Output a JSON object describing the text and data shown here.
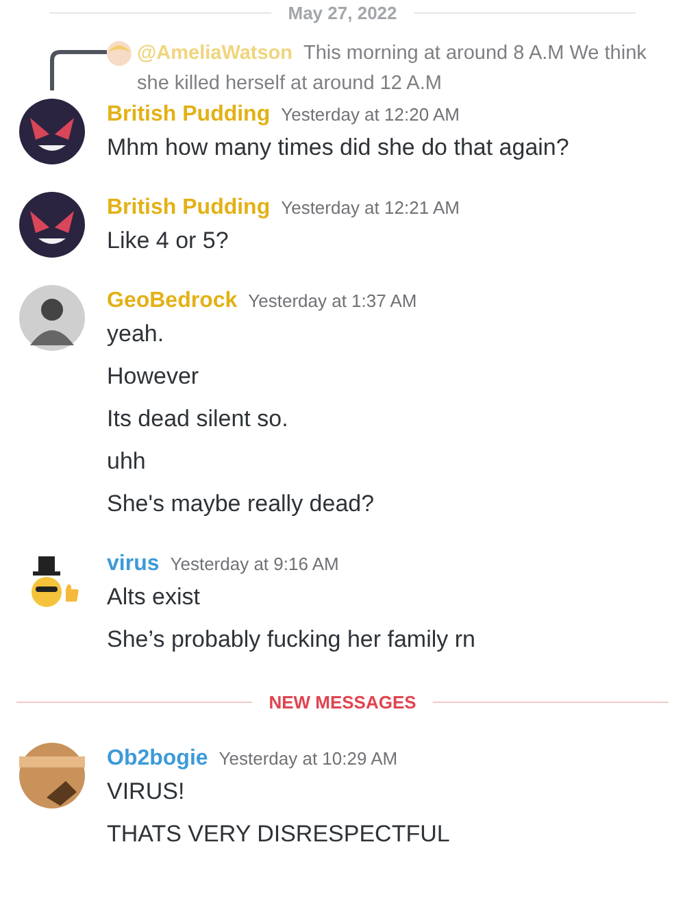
{
  "feed": [
    {
      "kind": "date",
      "label": "May 27, 2022"
    },
    {
      "kind": "message",
      "author": "British Pudding",
      "color": "#e3b116",
      "time": "Yesterday at 12:20 AM",
      "reply": {
        "author": "@AmeliaWatson",
        "color": "#efd57e",
        "text": "This morning at around 8 A.M  We think she killed herself at around 12 A.M"
      },
      "lines": [
        "Mhm how many times did she do that again?"
      ]
    },
    {
      "kind": "message",
      "author": "British Pudding",
      "color": "#e3b116",
      "time": "Yesterday at 12:21 AM",
      "lines": [
        "Like 4 or 5?"
      ]
    },
    {
      "kind": "message",
      "author": "GeoBedrock",
      "color": "#e3b116",
      "time": "Yesterday at 1:37 AM",
      "lines": [
        "yeah.",
        "However",
        "Its dead silent so.",
        "uhh",
        "She's maybe really dead?"
      ]
    },
    {
      "kind": "message",
      "author": "virus",
      "color": "#3d9ad9",
      "time": "Yesterday at 9:16 AM",
      "lines": [
        "Alts exist",
        "She’s probably fucking her family rn"
      ]
    },
    {
      "kind": "new",
      "label": "NEW MESSAGES"
    },
    {
      "kind": "message",
      "author": "Ob2bogie",
      "color": "#3d9ad9",
      "time": "Yesterday at 10:29 AM",
      "lines": [
        "VIRUS!",
        "THATS VERY DISRESPECTFUL"
      ]
    }
  ]
}
